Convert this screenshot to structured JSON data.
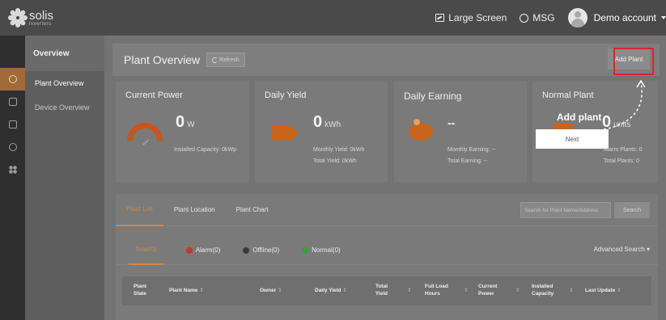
{
  "header": {
    "logo_name": "solis",
    "logo_sub": "inverters",
    "large_screen": "Large Screen",
    "msg": "MSG",
    "account": "Demo account"
  },
  "subnav": {
    "heading": "Overview",
    "items": [
      {
        "label": "Plant Overview"
      },
      {
        "label": "Device Overview"
      }
    ]
  },
  "page": {
    "title": "Plant Overview",
    "refresh": "Refresh",
    "add_plant": "Add Plant"
  },
  "cards": {
    "current_power": {
      "title": "Current Power",
      "value": "0",
      "unit": "W",
      "installed": "Installed Capacity: 0kWp"
    },
    "daily_yield": {
      "title": "Daily Yield",
      "value": "0",
      "unit": "kWh",
      "monthly": "Monthly Yield: 0kWh",
      "total": "Total Yield: 0kWh"
    },
    "daily_earning": {
      "title": "Daily Earning",
      "value": "--",
      "monthly": "Monthly Earning: --",
      "total": "Total Earning: --"
    },
    "normal_plant": {
      "title": "Normal Plant",
      "value": "0",
      "unit": "units",
      "alarm": "Alarm Plants: 0",
      "total": "Total Plants: 0"
    }
  },
  "tooltip": {
    "title": "Add plant",
    "next": "Next"
  },
  "tabs": [
    "Plant List",
    "Plant Location",
    "Plant Chart"
  ],
  "search": {
    "placeholder": "Search for Plant Name/Address",
    "button": "Search"
  },
  "filters": {
    "total": "Total(0)",
    "alarm": "Alarm(0)",
    "offline": "Offline(0)",
    "normal": "Normal(0)",
    "advanced": "Advanced Search ▾"
  },
  "table": {
    "headers": {
      "state": "Plant State",
      "name": "Plant Name",
      "owner": "Owner",
      "daily_yield": "Daily Yield",
      "total_yield": "Total Yield",
      "full_load": "Full Load Hours",
      "current_power": "Current Power",
      "installed": "Installed Capacity",
      "last_update": "Last Update"
    }
  },
  "colors": {
    "alarm": "#c0392b",
    "offline": "#3a3a3a",
    "normal": "#3f9b3a",
    "accent": "#c98a4e",
    "highlight": "#d9262b"
  }
}
